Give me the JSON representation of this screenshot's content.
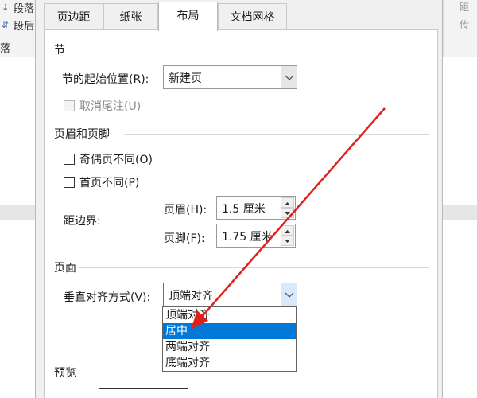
{
  "ribbon": {
    "left_items": [
      "段落",
      "段后",
      "落"
    ],
    "right_items": [
      "距",
      "传"
    ]
  },
  "dialog": {
    "tabs": [
      {
        "label": "页边距",
        "active": false
      },
      {
        "label": "纸张",
        "active": false
      },
      {
        "label": "布局",
        "active": true
      },
      {
        "label": "文档网格",
        "active": false
      }
    ],
    "section_start": {
      "title": "节",
      "start_label": "节的起始位置(R):",
      "start_value": "新建页",
      "suppress_endnotes_label": "取消尾注(U)"
    },
    "header_footer": {
      "title": "页眉和页脚",
      "odd_even_label": "奇偶页不同(O)",
      "first_page_label": "首页不同(P)",
      "from_edge_label": "距边界:",
      "header_label": "页眉(H):",
      "header_value": "1.5 厘米",
      "footer_label": "页脚(F):",
      "footer_value": "1.75 厘米"
    },
    "page": {
      "title": "页面",
      "valign_label": "垂直对齐方式(V):",
      "valign_value": "顶端对齐",
      "options": [
        "顶端对齐",
        "居中",
        "两端对齐",
        "底端对齐"
      ],
      "highlighted_option": "居中"
    },
    "preview": {
      "title": "预览"
    }
  },
  "colors": {
    "annotation_arrow": "#e0201c",
    "highlight": "#0078d7"
  }
}
